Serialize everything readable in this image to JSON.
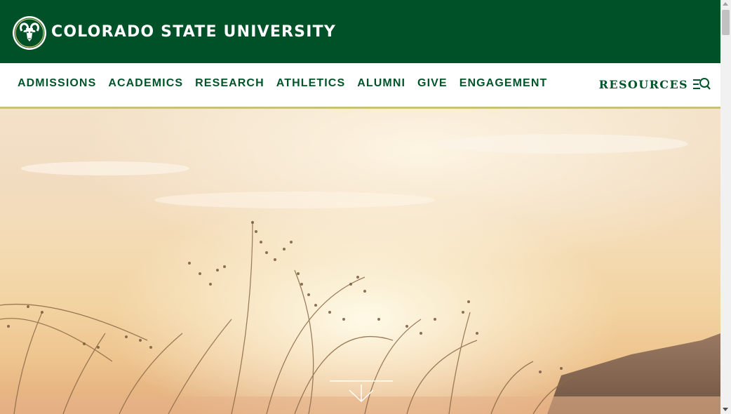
{
  "header": {
    "university_name": "COLORADO STATE UNIVERSITY",
    "logo_icon": "ram-logo-icon",
    "background_color": "#005127"
  },
  "nav": {
    "items": [
      {
        "label": "ADMISSIONS"
      },
      {
        "label": "ACADEMICS"
      },
      {
        "label": "RESEARCH"
      },
      {
        "label": "ATHLETICS"
      },
      {
        "label": "ALUMNI"
      },
      {
        "label": "GIVE"
      },
      {
        "label": "ENGAGEMENT"
      }
    ],
    "resources_label": "RESOURCES",
    "resources_icon": "menu-search-icon",
    "text_color": "#00542a",
    "accent_border_color": "#c8c372"
  },
  "hero": {
    "image_description_icon": "sunset-grass-image",
    "scroll_icon": "chevron-down-icon"
  }
}
